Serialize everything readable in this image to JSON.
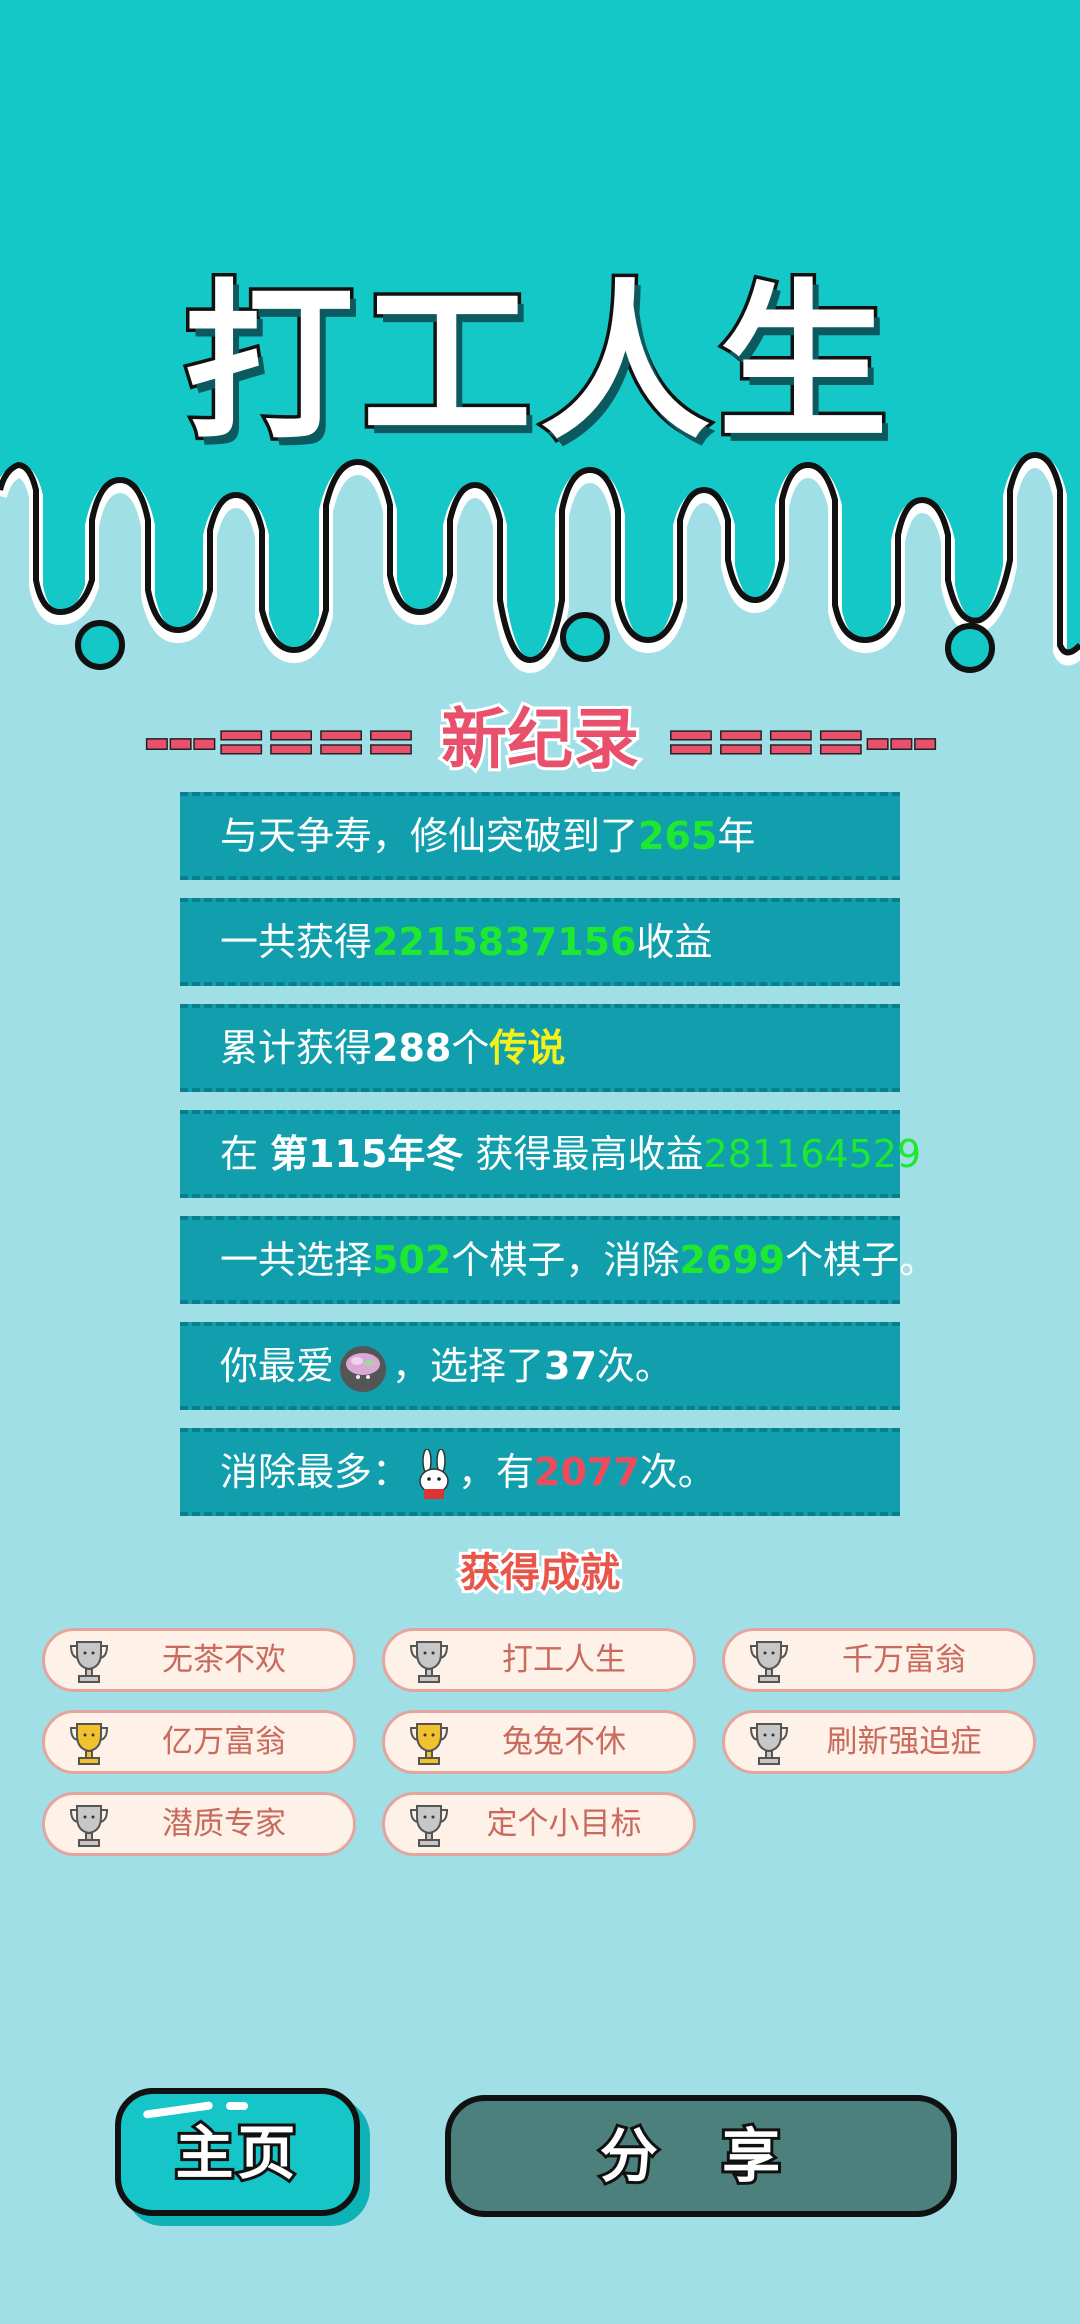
{
  "header": {
    "title": "打工人生"
  },
  "record": {
    "left_deco": "---====",
    "title": "新纪录",
    "right_deco": "====---"
  },
  "stats": {
    "s1": {
      "pre": "与天争寿，修仙突破到了",
      "value": "265",
      "post": "年"
    },
    "s2": {
      "pre": "一共获得",
      "value": "2215837156",
      "post": "收益"
    },
    "s3": {
      "pre": "累计获得",
      "value": "288",
      "mid": "个",
      "tag": "传说"
    },
    "s4": {
      "pre": "在 ",
      "season": "第115年冬",
      "mid": " 获得最高收益",
      "value": "281164529"
    },
    "s5": {
      "pre": "一共选择",
      "value1": "502",
      "mid": "个棋子，消除",
      "value2": "2699",
      "post": "个棋子。"
    },
    "s6": {
      "pre": "你最爱",
      "icon": "coin-pile-icon",
      "mid": "，选择了",
      "value": "37",
      "post": "次。"
    },
    "s7": {
      "pre": "消除最多：",
      "icon": "rabbit-icon",
      "mid": "，有",
      "value": "2077",
      "post": "次。"
    }
  },
  "achievements": {
    "title": "获得成就",
    "items": [
      {
        "label": "无茶不欢",
        "trophy": "silver"
      },
      {
        "label": "打工人生",
        "trophy": "silver"
      },
      {
        "label": "千万富翁",
        "trophy": "silver"
      },
      {
        "label": "亿万富翁",
        "trophy": "gold"
      },
      {
        "label": "兔兔不休",
        "trophy": "gold"
      },
      {
        "label": "刷新强迫症",
        "trophy": "silver"
      },
      {
        "label": "潜质专家",
        "trophy": "silver"
      },
      {
        "label": "定个小目标",
        "trophy": "silver"
      }
    ]
  },
  "buttons": {
    "home": "主页",
    "share": "分 享"
  },
  "colors": {
    "background": "#a1dfe6",
    "header": "#15c8c8",
    "card": "#119fae",
    "highlight_green": "#1ee82f",
    "highlight_yellow": "#f4f01a",
    "highlight_red": "#ef4b5c",
    "record_pink": "#e8506b",
    "trophy_gold": "#f2c12e",
    "trophy_silver": "#c7c7c7",
    "share_button": "#4c807d"
  }
}
